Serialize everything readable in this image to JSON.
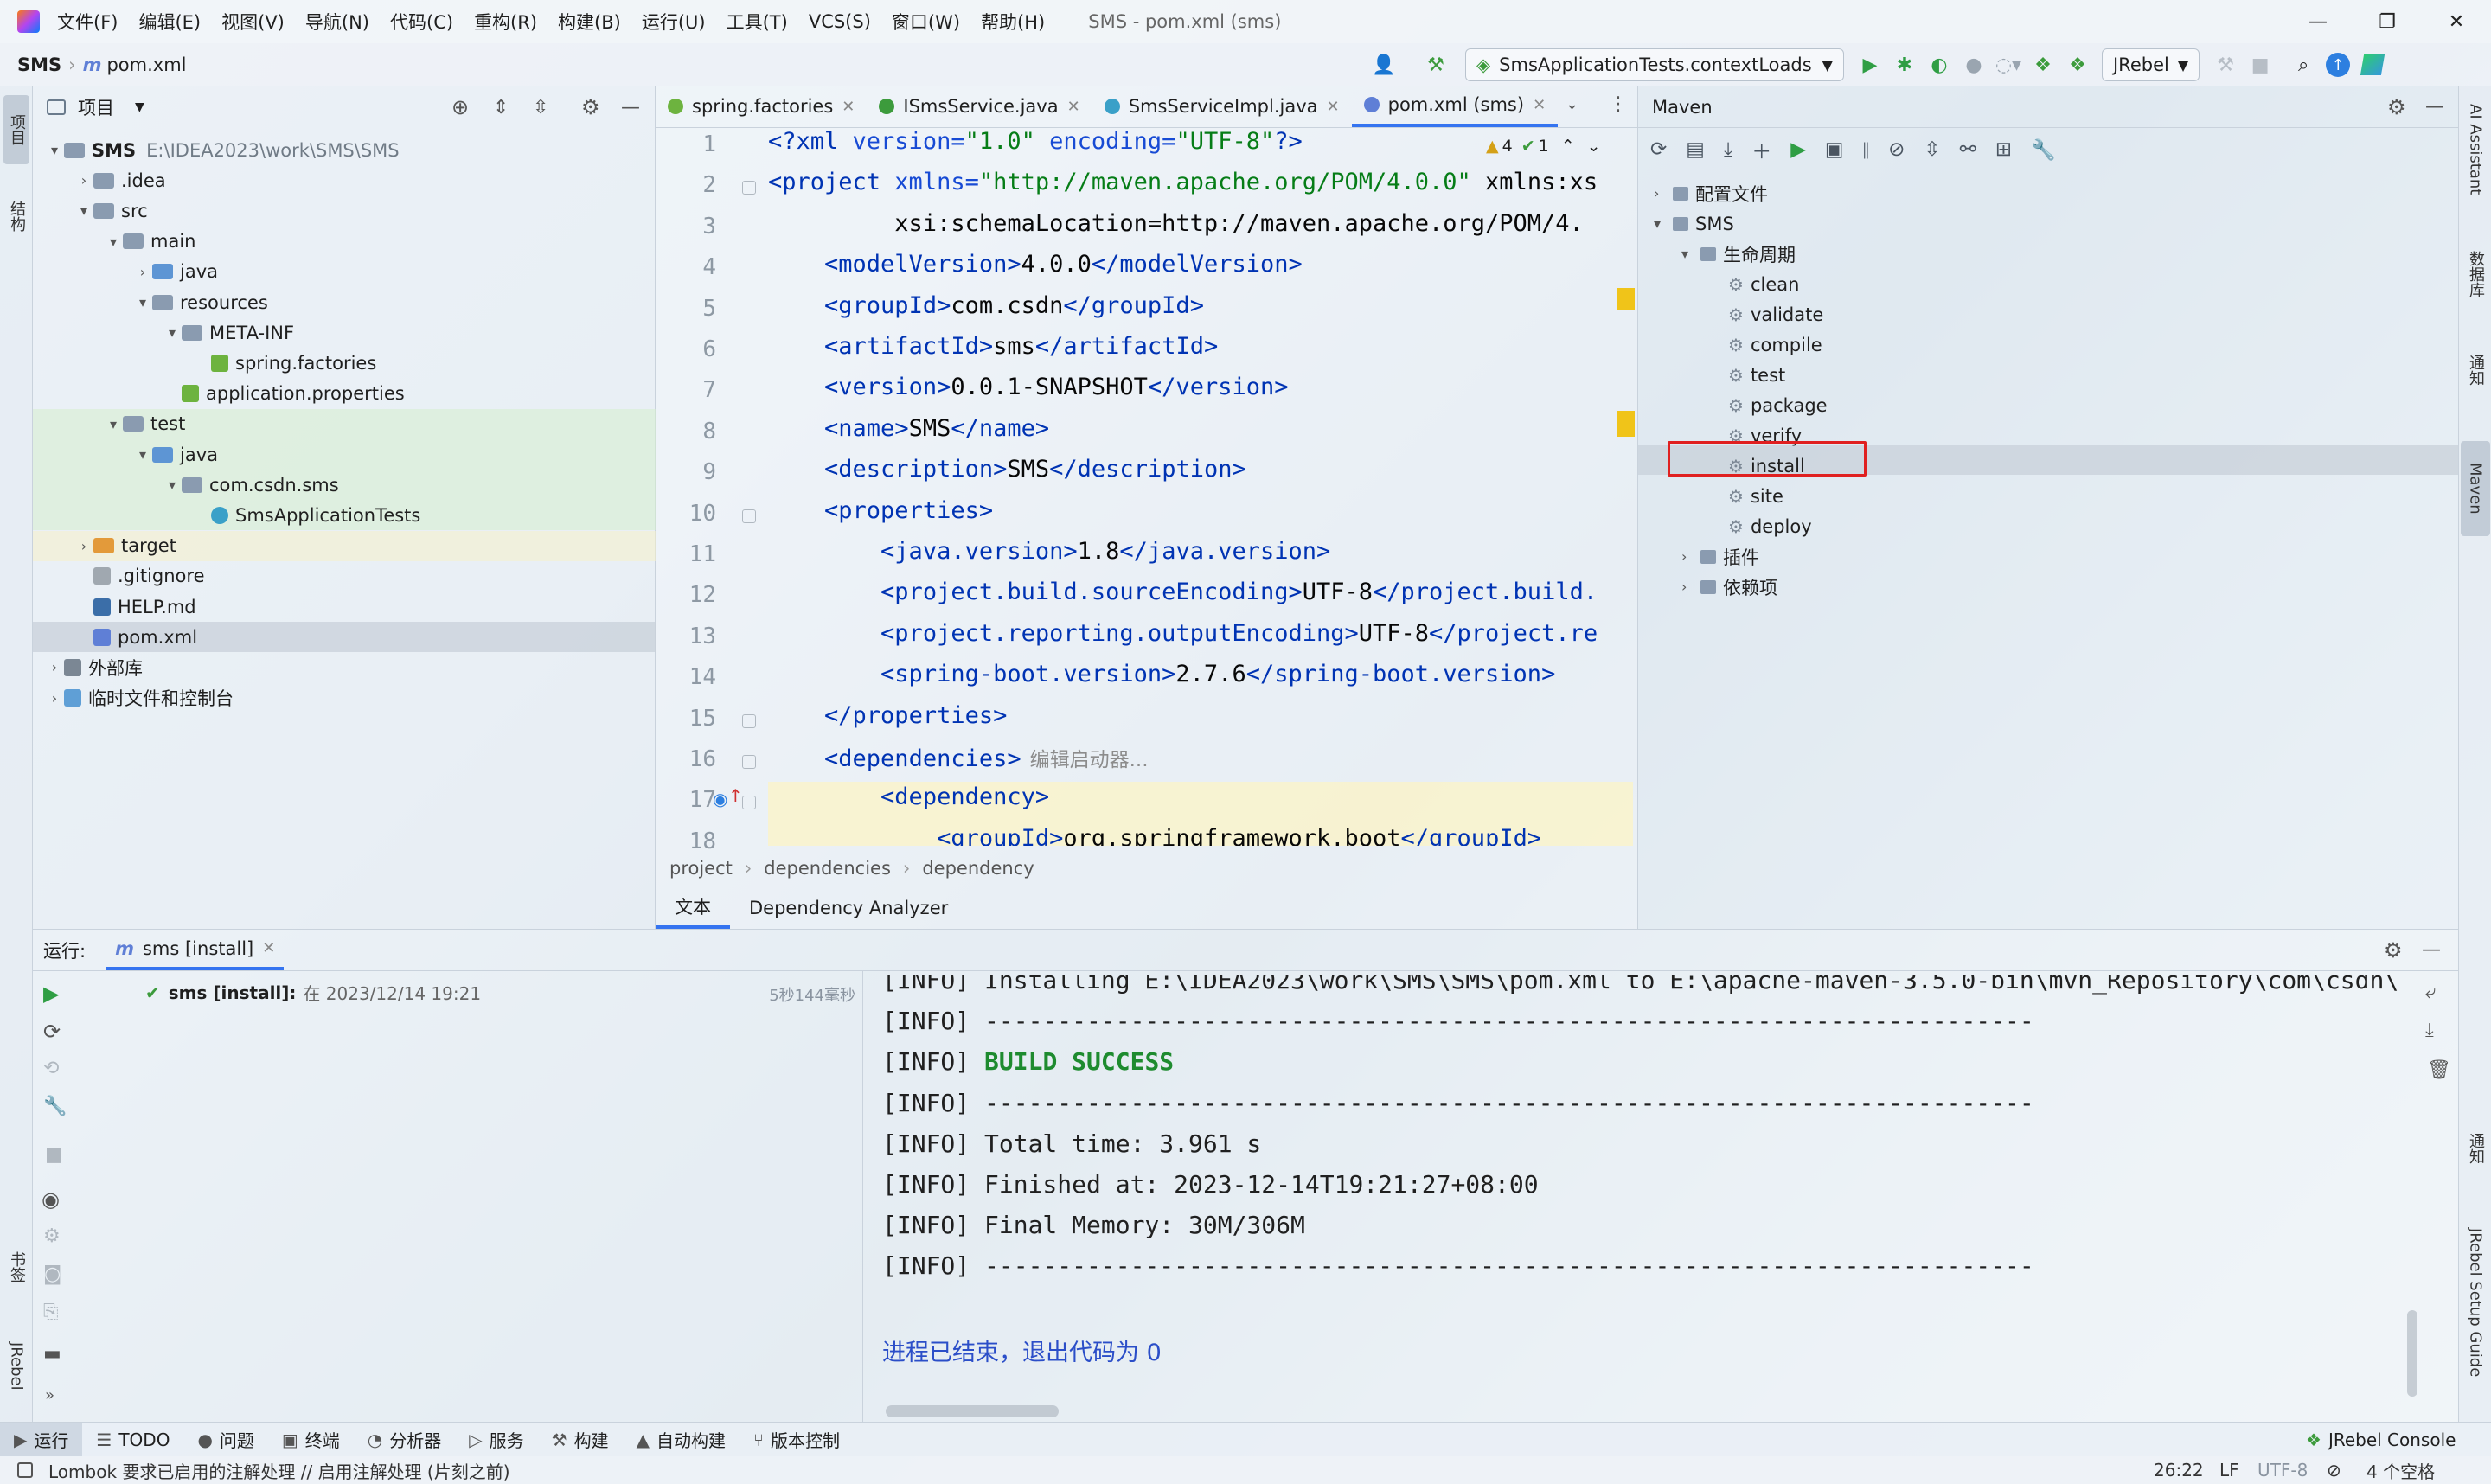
{
  "menu": [
    "文件(F)",
    "编辑(E)",
    "视图(V)",
    "导航(N)",
    "代码(C)",
    "重构(R)",
    "构建(B)",
    "运行(U)",
    "工具(T)",
    "VCS(S)",
    "窗口(W)",
    "帮助(H)"
  ],
  "window_title": "SMS - pom.xml (sms)",
  "nav": {
    "project": "SMS",
    "file": "pom.xml",
    "run_config": "SmsApplicationTests.contextLoads",
    "jrebel": "JRebel"
  },
  "left_strip": {
    "project": "项目",
    "structure": "结构",
    "bookmarks": "书签",
    "jrebel": "JRebel"
  },
  "right_strip": {
    "ai": "AI Assistant",
    "db": "数据库",
    "notify": "通知",
    "maven": "Maven",
    "notify2": "通知",
    "jrebel_guide": "JRebel Setup Guide"
  },
  "project_panel": {
    "title": "项目",
    "tree": [
      {
        "label": "SMS",
        "extra": "E:\\IDEA2023\\work\\SMS\\SMS",
        "indent": 0,
        "arrow": "▾",
        "icon": "folder"
      },
      {
        "label": ".idea",
        "indent": 1,
        "arrow": "›",
        "icon": "folder"
      },
      {
        "label": "src",
        "indent": 1,
        "arrow": "▾",
        "icon": "folder"
      },
      {
        "label": "main",
        "indent": 2,
        "arrow": "▾",
        "icon": "folder"
      },
      {
        "label": "java",
        "indent": 3,
        "arrow": "›",
        "icon": "folder-blue"
      },
      {
        "label": "resources",
        "indent": 3,
        "arrow": "▾",
        "icon": "folder"
      },
      {
        "label": "META-INF",
        "indent": 4,
        "arrow": "▾",
        "icon": "folder"
      },
      {
        "label": "spring.factories",
        "indent": 5,
        "arrow": "",
        "icon": "spring"
      },
      {
        "label": "application.properties",
        "indent": 4,
        "arrow": "",
        "icon": "spring"
      },
      {
        "label": "test",
        "indent": 2,
        "arrow": "▾",
        "icon": "folder"
      },
      {
        "label": "java",
        "indent": 3,
        "arrow": "▾",
        "icon": "folder-green"
      },
      {
        "label": "com.csdn.sms",
        "indent": 4,
        "arrow": "▾",
        "icon": "folder"
      },
      {
        "label": "SmsApplicationTests",
        "indent": 5,
        "arrow": "",
        "icon": "class"
      },
      {
        "label": "target",
        "indent": 1,
        "arrow": "›",
        "icon": "folder-orange"
      },
      {
        "label": ".gitignore",
        "indent": 1,
        "arrow": "",
        "icon": "file"
      },
      {
        "label": "HELP.md",
        "indent": 1,
        "arrow": "",
        "icon": "md"
      },
      {
        "label": "pom.xml",
        "indent": 1,
        "arrow": "",
        "icon": "maven"
      },
      {
        "label": "外部库",
        "indent": 0,
        "arrow": "›",
        "icon": "lib"
      },
      {
        "label": "临时文件和控制台",
        "indent": 0,
        "arrow": "›",
        "icon": "scratch"
      }
    ]
  },
  "editor": {
    "tabs": [
      "spring.factories",
      "ISmsService.java",
      "SmsServiceImpl.java",
      "pom.xml (sms)"
    ],
    "inspections": {
      "warnings": "4",
      "ok": "1"
    },
    "line_numbers": [
      "1",
      "2",
      "3",
      "4",
      "5",
      "6",
      "7",
      "8",
      "9",
      "10",
      "11",
      "12",
      "13",
      "14",
      "15",
      "16",
      "17",
      "18"
    ],
    "lines": [
      "<?xml version=\"1.0\" encoding=\"UTF-8\"?>",
      "<project xmlns=\"http://maven.apache.org/POM/4.0.0\" xmlns:xs",
      "         xsi:schemaLocation=\"http://maven.apache.org/POM/4.",
      "    <modelVersion>4.0.0</modelVersion>",
      "    <groupId>com.csdn</groupId>",
      "    <artifactId>sms</artifactId>",
      "    <version>0.0.1-SNAPSHOT</version>",
      "    <name>SMS</name>",
      "    <description>SMS</description>",
      "    <properties>",
      "        <java.version>1.8</java.version>",
      "        <project.build.sourceEncoding>UTF-8</project.build.",
      "        <project.reporting.outputEncoding>UTF-8</project.re",
      "        <spring-boot.version>2.7.6</spring-boot.version>",
      "    </properties>",
      "    <dependencies>",
      "        <dependency>",
      "            <groupId>org.springframework.boot</groupId>"
    ],
    "deps_hint": "编辑启动器...",
    "breadcrumbs": [
      "project",
      "dependencies",
      "dependency"
    ],
    "bottom_tabs": [
      "文本",
      "Dependency Analyzer"
    ]
  },
  "maven": {
    "title": "Maven",
    "tree": [
      {
        "label": "配置文件",
        "indent": 0,
        "arrow": "›"
      },
      {
        "label": "SMS",
        "indent": 0,
        "arrow": "▾"
      },
      {
        "label": "生命周期",
        "indent": 1,
        "arrow": "▾"
      },
      {
        "label": "clean",
        "indent": 2,
        "arrow": ""
      },
      {
        "label": "validate",
        "indent": 2,
        "arrow": ""
      },
      {
        "label": "compile",
        "indent": 2,
        "arrow": ""
      },
      {
        "label": "test",
        "indent": 2,
        "arrow": ""
      },
      {
        "label": "package",
        "indent": 2,
        "arrow": ""
      },
      {
        "label": "verify",
        "indent": 2,
        "arrow": ""
      },
      {
        "label": "install",
        "indent": 2,
        "arrow": ""
      },
      {
        "label": "site",
        "indent": 2,
        "arrow": ""
      },
      {
        "label": "deploy",
        "indent": 2,
        "arrow": ""
      },
      {
        "label": "插件",
        "indent": 1,
        "arrow": "›"
      },
      {
        "label": "依赖项",
        "indent": 1,
        "arrow": "›"
      }
    ],
    "highlight_color": "#e02020"
  },
  "run": {
    "label": "运行:",
    "tab": "sms [install]",
    "entry_title": "sms [install]:",
    "entry_time": "在 2023/12/14 19:21",
    "duration": "5秒144毫秒",
    "console": [
      "[INFO] Installing E:\\IDEA2023\\work\\SMS\\SMS\\pom.xml to E:\\apache-maven-3.5.0-bin\\mvn_Repository\\com\\csdn\\",
      "[INFO] ------------------------------------------------------------------------",
      "[INFO] BUILD SUCCESS",
      "[INFO] ------------------------------------------------------------------------",
      "[INFO] Total time: 3.961 s",
      "[INFO] Finished at: 2023-12-14T19:21:27+08:00",
      "[INFO] Final Memory: 30M/306M",
      "[INFO] ------------------------------------------------------------------------",
      "",
      "进程已结束，退出代码为 0"
    ]
  },
  "bottom_tools": [
    "运行",
    "TODO",
    "问题",
    "终端",
    "分析器",
    "服务",
    "构建",
    "自动构建",
    "版本控制"
  ],
  "bottom_right": "JRebel Console",
  "status": {
    "message": "Lombok 要求已启用的注解处理 // 启用注解处理 (片刻之前)",
    "position": "26:22",
    "line_sep": "LF",
    "encoding": "UTF-8",
    "indent": "4 个空格"
  }
}
